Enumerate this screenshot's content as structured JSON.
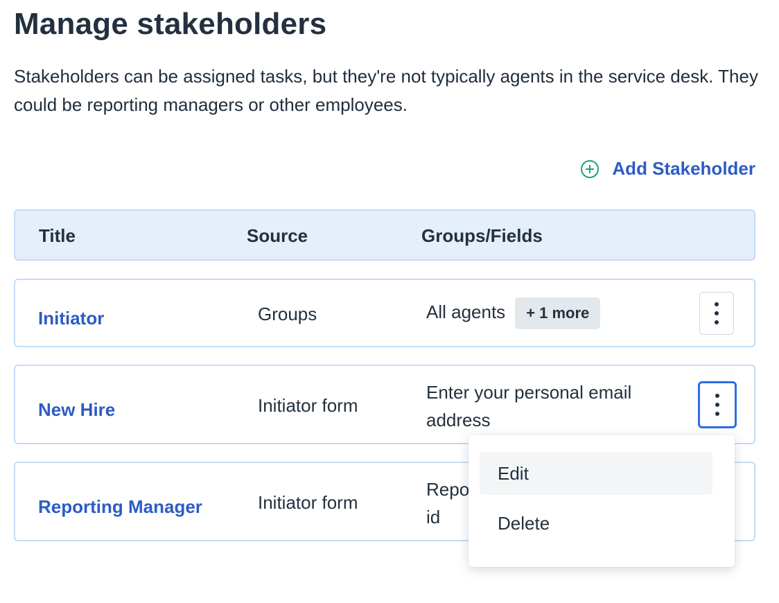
{
  "page": {
    "title": "Manage stakeholders",
    "description": "Stakeholders can be assigned tasks, but they're not typically agents in the service desk. They could be reporting managers or other employees."
  },
  "add_button": {
    "label": "Add Stakeholder",
    "icon": "plus-circle-icon",
    "icon_color": "#1aa37a"
  },
  "table": {
    "columns": [
      "Title",
      "Source",
      "Groups/Fields"
    ],
    "rows": [
      {
        "title": "Initiator",
        "source": "Groups",
        "fields": "All agents",
        "badge": "+ 1 more"
      },
      {
        "title": "New Hire",
        "source": "Initiator form",
        "fields": "Enter your personal email address"
      },
      {
        "title": "Reporting Manager",
        "source": "Initiator form",
        "fields": "Repo id"
      }
    ]
  },
  "row_menu": {
    "items": [
      "Edit",
      "Delete"
    ]
  },
  "colors": {
    "link": "#2c5cc5",
    "header_bg": "#e4effb",
    "border": "#c3dcf6",
    "focus": "#2c6ce5"
  }
}
